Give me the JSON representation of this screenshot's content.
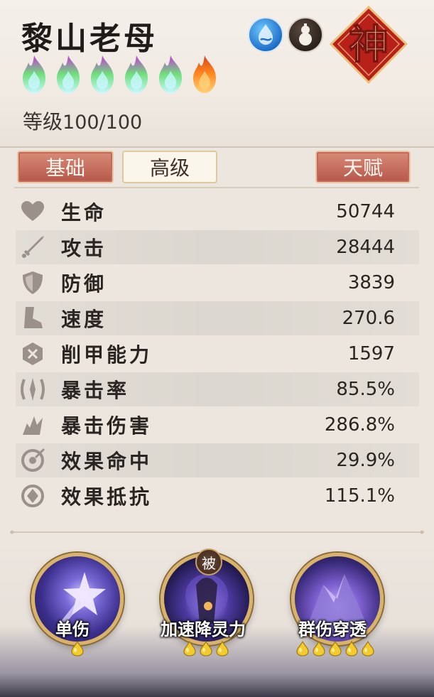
{
  "hero": {
    "name": "黎山老母",
    "level_label": "等级",
    "level_value": "100/100",
    "star_flames": {
      "total": 6,
      "green": 5,
      "orange": 1
    },
    "god_badge": "神",
    "element_icons": [
      "water-icon",
      "gourd-icon"
    ]
  },
  "tabs": {
    "basic": "基础",
    "advanced": "高级",
    "talent": "天赋"
  },
  "stats": [
    {
      "icon": "heart-icon",
      "label": "生命",
      "value": "50744"
    },
    {
      "icon": "sword-icon",
      "label": "攻击",
      "value": "28444"
    },
    {
      "icon": "shield-icon",
      "label": "防御",
      "value": "3839"
    },
    {
      "icon": "boot-icon",
      "label": "速度",
      "value": "270.6"
    },
    {
      "icon": "armor-break-icon",
      "label": "削甲能力",
      "value": "1597"
    },
    {
      "icon": "crit-rate-icon",
      "label": "暴击率",
      "value": "85.5%"
    },
    {
      "icon": "crit-damage-icon",
      "label": "暴击伤害",
      "value": "286.8%"
    },
    {
      "icon": "effect-hit-icon",
      "label": "效果命中",
      "value": "29.9%"
    },
    {
      "icon": "effect-resist-icon",
      "label": "效果抵抗",
      "value": "115.1%"
    }
  ],
  "skills": [
    {
      "name": "单伤",
      "cost": 1
    },
    {
      "name": "加速降灵力",
      "cost": 3,
      "passive_badge": "被"
    },
    {
      "name": "群伤穿透",
      "cost": 5
    }
  ],
  "colors": {
    "tab_red": "#c46a59",
    "tab_light": "#fbf6ec",
    "gold_border": "#d9b36b",
    "god_red": "#c8281e"
  }
}
